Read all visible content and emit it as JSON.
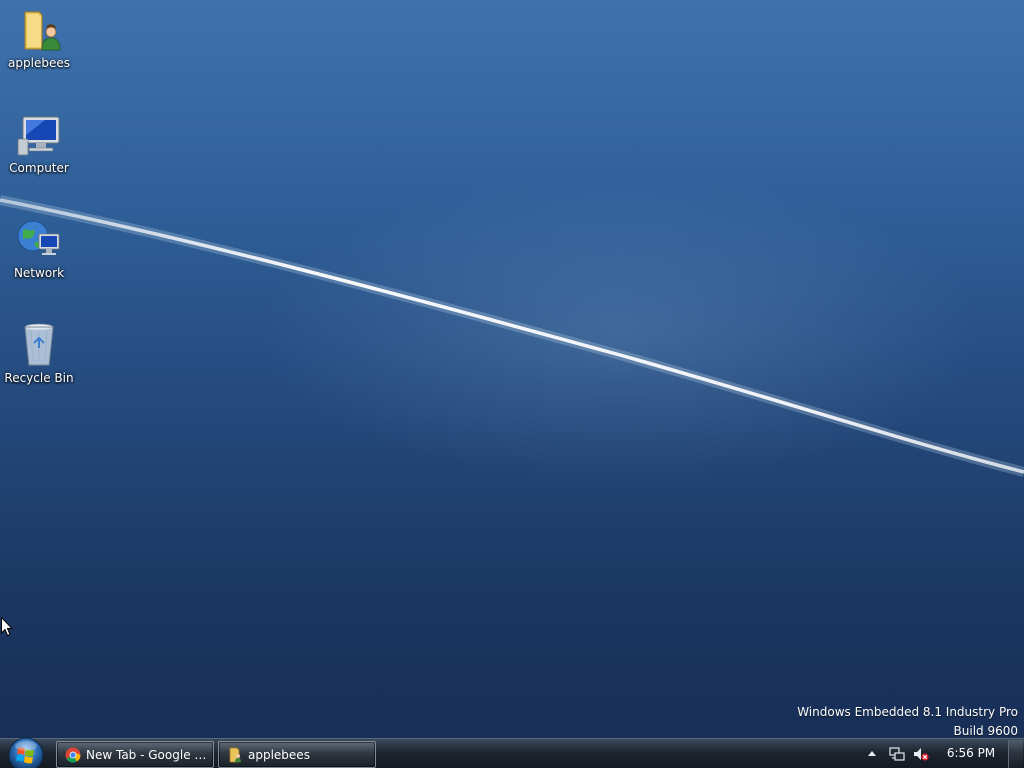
{
  "desktop": {
    "icons": [
      {
        "label": "applebees",
        "icon": "user-folder-icon"
      },
      {
        "label": "Computer",
        "icon": "computer-icon"
      },
      {
        "label": "Network",
        "icon": "network-icon"
      },
      {
        "label": "Recycle Bin",
        "icon": "recycle-bin-icon"
      }
    ],
    "watermark": {
      "line1": "Windows Embedded 8.1 Industry Pro",
      "line2": "Build 9600"
    }
  },
  "taskbar": {
    "start_icon": "windows-start-orb-icon",
    "buttons": [
      {
        "label": "New Tab - Google C...",
        "icon": "chrome-icon"
      },
      {
        "label": "applebees",
        "icon": "folder-icon"
      }
    ],
    "tray": {
      "icons": [
        "show-hidden-icons-arrow-icon",
        "network-tray-icon",
        "volume-muted-icon"
      ],
      "clock": "6:56 PM"
    }
  },
  "colors": {
    "desktop_top": "#3f72ad",
    "desktop_bottom": "#182f57",
    "taskbar": "#1d2530"
  }
}
